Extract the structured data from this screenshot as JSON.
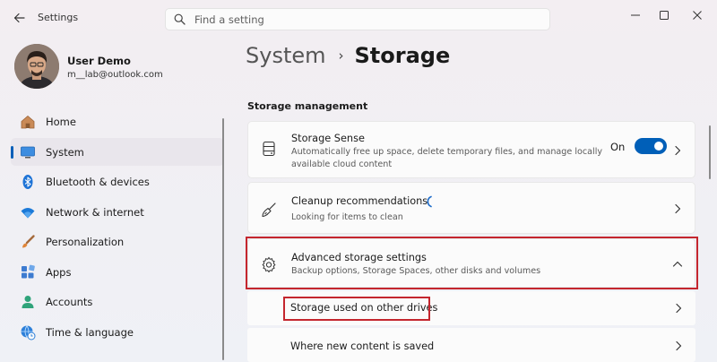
{
  "window": {
    "title": "Settings",
    "back_icon": "arrow-left-icon",
    "controls": [
      "minimize-icon",
      "maximize-icon",
      "close-icon"
    ]
  },
  "search": {
    "placeholder": "Find a setting",
    "value": "",
    "icon": "search-icon"
  },
  "user": {
    "name": "User Demo",
    "email": "m__lab@outlook.com"
  },
  "nav": {
    "items": [
      {
        "label": "Home",
        "icon": "home-icon",
        "active": false
      },
      {
        "label": "System",
        "icon": "system-monitor-icon",
        "active": true
      },
      {
        "label": "Bluetooth & devices",
        "icon": "bluetooth-icon",
        "active": false
      },
      {
        "label": "Network & internet",
        "icon": "wifi-icon",
        "active": false
      },
      {
        "label": "Personalization",
        "icon": "paintbrush-icon",
        "active": false
      },
      {
        "label": "Apps",
        "icon": "apps-icon",
        "active": false
      },
      {
        "label": "Accounts",
        "icon": "account-icon",
        "active": false
      },
      {
        "label": "Time & language",
        "icon": "globe-clock-icon",
        "active": false
      }
    ]
  },
  "breadcrumb": {
    "parent": "System",
    "separator": "›",
    "current": "Storage"
  },
  "main": {
    "section_title": "Storage management",
    "storage_sense": {
      "title": "Storage Sense",
      "description_line1": "Automatically free up space, delete temporary files, and manage locally",
      "description_line2": "available cloud content",
      "toggle_label": "On",
      "toggle_on": true
    },
    "cleanup": {
      "title": "Cleanup recommendations",
      "description": "Looking for items to clean"
    },
    "advanced": {
      "title": "Advanced storage settings",
      "description": "Backup options, Storage Spaces, other disks and volumes",
      "expanded": true
    },
    "sub_items": [
      {
        "label": "Storage used on other drives"
      },
      {
        "label": "Where new content is saved"
      }
    ]
  },
  "colors": {
    "accent": "#005fb8",
    "highlight": "#c4262e"
  }
}
